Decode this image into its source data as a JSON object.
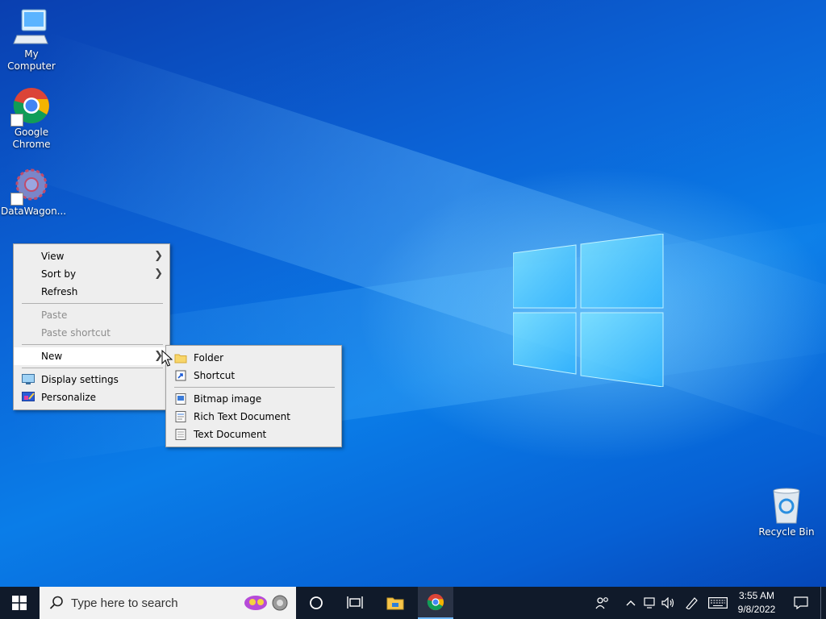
{
  "desktop": {
    "icons": [
      {
        "label": "My Computer",
        "icon": "computer-icon"
      },
      {
        "label": "Google Chrome",
        "icon": "chrome-icon"
      },
      {
        "label": "DataWagon...",
        "icon": "datawagon-icon"
      },
      {
        "label": "Recycle Bin",
        "icon": "recycle-bin-icon"
      }
    ]
  },
  "context_menu": {
    "items": [
      {
        "label": "View",
        "submenu": true,
        "enabled": true
      },
      {
        "label": "Sort by",
        "submenu": true,
        "enabled": true
      },
      {
        "label": "Refresh",
        "enabled": true
      },
      {
        "label": "Paste",
        "enabled": false
      },
      {
        "label": "Paste shortcut",
        "enabled": false
      },
      {
        "label": "New",
        "submenu": true,
        "enabled": true,
        "highlighted": true
      },
      {
        "label": "Display settings",
        "icon": "display-icon",
        "enabled": true
      },
      {
        "label": "Personalize",
        "icon": "personalize-icon",
        "enabled": true
      }
    ]
  },
  "new_submenu": {
    "items": [
      {
        "label": "Folder",
        "icon": "folder-icon"
      },
      {
        "label": "Shortcut",
        "icon": "shortcut-icon"
      },
      {
        "label": "Bitmap image",
        "icon": "bitmap-icon"
      },
      {
        "label": "Rich Text Document",
        "icon": "rtf-icon"
      },
      {
        "label": "Text Document",
        "icon": "text-document-icon"
      }
    ]
  },
  "taskbar": {
    "search_placeholder": "Type here to search",
    "time": "3:55 AM",
    "date": "9/8/2022"
  },
  "colors": {
    "taskbar": "#101a2a",
    "menu_bg": "#eeeeee",
    "accent": "#0b63d6"
  }
}
